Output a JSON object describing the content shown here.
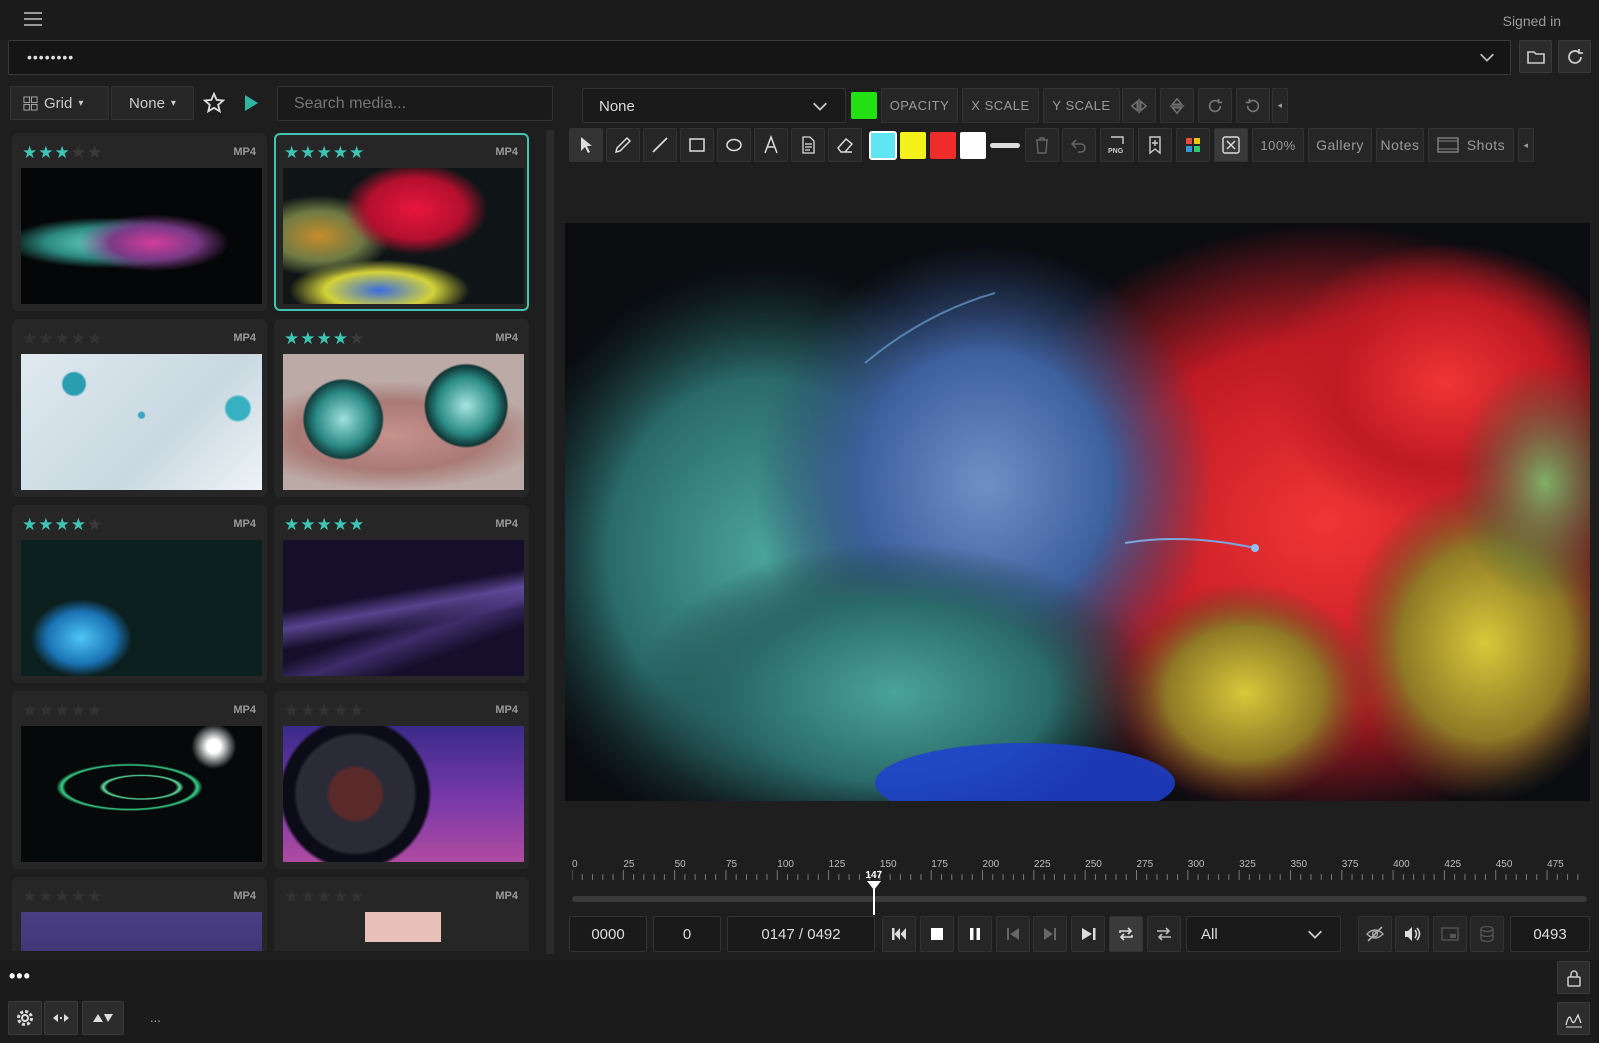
{
  "header": {
    "status": "Signed in",
    "path_value": "••••••••"
  },
  "left": {
    "view_label": "Grid",
    "filter_label": "None",
    "search_placeholder": "Search media...",
    "items": [
      {
        "rating": 3,
        "format": "MP4",
        "selected": false
      },
      {
        "rating": 5,
        "format": "MP4",
        "selected": true
      },
      {
        "rating": 0,
        "format": "MP4",
        "selected": false
      },
      {
        "rating": 4,
        "format": "MP4",
        "selected": false
      },
      {
        "rating": 4,
        "format": "MP4",
        "selected": false
      },
      {
        "rating": 5,
        "format": "MP4",
        "selected": false
      },
      {
        "rating": 0,
        "format": "MP4",
        "selected": false
      },
      {
        "rating": 0,
        "format": "MP4",
        "selected": false
      },
      {
        "rating": 0,
        "format": "MP4",
        "selected": false
      },
      {
        "rating": 0,
        "format": "MP4",
        "selected": false
      }
    ]
  },
  "toolbar": {
    "overlay_select": "None",
    "overlay_color": "#22e012",
    "opacity_label": "OPACITY",
    "xscale_label": "X SCALE",
    "yscale_label": "Y SCALE",
    "zoom": "100%",
    "gallery_label": "Gallery",
    "notes_label": "Notes",
    "shots_label": "Shots",
    "swatches": [
      "#5fe6f2",
      "#f4f21a",
      "#ef2b2b",
      "#ffffff"
    ]
  },
  "timeline": {
    "ticks": [
      "0",
      "25",
      "50",
      "75",
      "100",
      "125",
      "150",
      "175",
      "200",
      "225",
      "250",
      "275",
      "300",
      "325",
      "350",
      "375",
      "400",
      "425",
      "450",
      "475"
    ],
    "max_frame": 492,
    "current_frame": 147,
    "playhead_label": "147"
  },
  "controls": {
    "in_point": "0000",
    "offset": "0",
    "position": "0147 / 0492",
    "range_select": "All",
    "end_frame": "0493"
  },
  "footer": {
    "more": "•••",
    "ellipsis": "..."
  }
}
